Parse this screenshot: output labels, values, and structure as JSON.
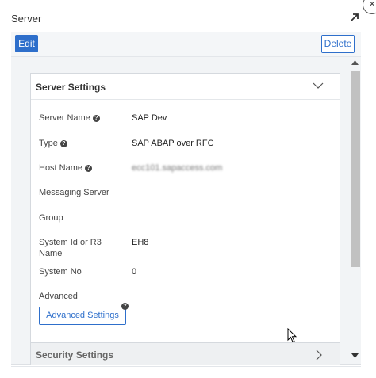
{
  "panel": {
    "title": "Server",
    "close_glyph": "×",
    "close_icon": "close-icon",
    "expand_icon": "arrow-up-right-icon"
  },
  "toolbar": {
    "edit_label": "Edit",
    "delete_label": "Delete"
  },
  "server_settings": {
    "title": "Server Settings",
    "chevron_icon": "chevron-down-icon",
    "rows": [
      {
        "label": "Server Name",
        "value": "SAP Dev",
        "help": true
      },
      {
        "label": "Type",
        "value": "SAP ABAP over RFC",
        "help": true
      },
      {
        "label": "Host Name",
        "value": "ecc101.sapaccess.com",
        "help": true
      },
      {
        "label": "Messaging Server",
        "value": "",
        "help": false
      },
      {
        "label": "Group",
        "value": "",
        "help": false
      },
      {
        "label": "System Id or R3 Name",
        "value": "EH8",
        "help": false
      },
      {
        "label": "System No",
        "value": "0",
        "help": false
      },
      {
        "label": "Advanced",
        "value": "",
        "help": false
      }
    ],
    "help_glyph": "?",
    "advanced_button_label": "Advanced Settings"
  },
  "security_settings": {
    "title": "Security Settings",
    "chevron_icon": "chevron-right-icon"
  },
  "colors": {
    "accent": "#2e6fcb",
    "panel_bg": "#f2f4f6",
    "scroll_thumb": "#c1c1c1"
  }
}
